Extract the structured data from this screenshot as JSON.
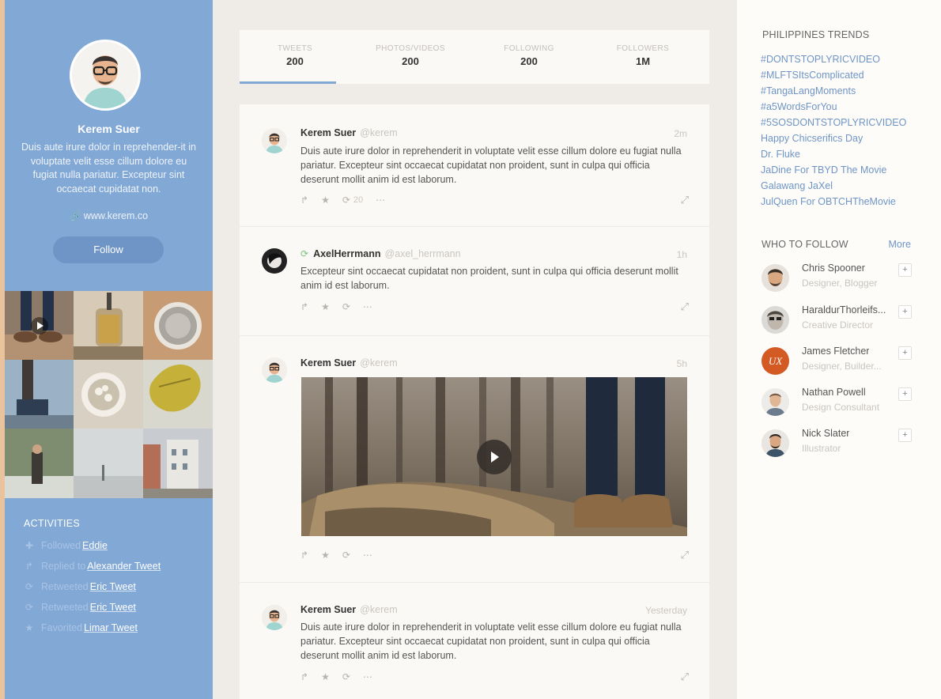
{
  "profile": {
    "name": "Kerem Suer",
    "bio": "Duis aute irure dolor in reprehender-it in voluptate velit esse cillum dolore eu fugiat nulla pariatur. Excepteur sint occaecat cupidatat non.",
    "website": "www.kerem.co",
    "follow_label": "Follow"
  },
  "activities": {
    "title": "ACTIVITIES",
    "items": [
      {
        "icon": "plus-icon",
        "verb": "Followed",
        "target": "Eddie"
      },
      {
        "icon": "reply-icon",
        "verb": "Replied to",
        "target": "Alexander Tweet"
      },
      {
        "icon": "retweet-icon",
        "verb": "Retweeted",
        "target": "Eric Tweet"
      },
      {
        "icon": "retweet-icon",
        "verb": "Retweeted",
        "target": "Eric Tweet"
      },
      {
        "icon": "star-icon",
        "verb": "Favorited",
        "target": "Limar Tweet"
      }
    ]
  },
  "stats": [
    {
      "label": "TWEETS",
      "value": "200"
    },
    {
      "label": "PHOTOS/VIDEOS",
      "value": "200"
    },
    {
      "label": "FOLLOWING",
      "value": "200"
    },
    {
      "label": "FOLLOWERS",
      "value": "1M"
    }
  ],
  "tweets": [
    {
      "name": "Kerem Suer",
      "handle": "@kerem",
      "time": "2m",
      "text": "Duis aute irure dolor in reprehenderit in voluptate velit esse cillum dolore eu fugiat nulla pariatur. Excepteur sint occaecat cupidatat non proident, sunt in culpa qui officia deserunt mollit anim id est laborum.",
      "retweets": "20"
    },
    {
      "name": "AxelHerrmann",
      "handle": "@axel_herrmann",
      "time": "1h",
      "text": "Excepteur sint occaecat cupidatat non proident, sunt in culpa qui officia deserunt mollit anim id est laborum."
    },
    {
      "name": "Kerem Suer",
      "handle": "@kerem",
      "time": "5h"
    },
    {
      "name": "Kerem Suer",
      "handle": "@kerem",
      "time": "Yesterday",
      "text": "Duis aute irure dolor in reprehenderit in voluptate velit esse cillum dolore eu fugiat nulla pariatur. Excepteur sint occaecat cupidatat non proident, sunt in culpa qui officia deserunt mollit anim id est laborum."
    }
  ],
  "trends": {
    "title": "PHILIPPINES TRENDS",
    "items": [
      "#DONTSTOPLYRICVIDEO",
      "#MLFTSItsComplicated",
      "#TangaLangMoments",
      "#a5WordsForYou",
      "#5SOSDONTSTOPLYRICVIDEO",
      "Happy Chicserifics Day",
      "Dr. Fluke",
      "JaDine For TBYD The Movie",
      "Galawang JaXel",
      "JulQuen For OBTCHTheMovie"
    ]
  },
  "who_to_follow": {
    "title": "WHO TO FOLLOW",
    "more_label": "More",
    "add_label": "+",
    "people": [
      {
        "name": "Chris Spooner",
        "role": "Designer, Blogger"
      },
      {
        "name": "HaraldurThorleifs...",
        "role": "Creative Director"
      },
      {
        "name": "James Fletcher",
        "role": "Designer, Builder..."
      },
      {
        "name": "Nathan Powell",
        "role": "Design Consultant"
      },
      {
        "name": "Nick Slater",
        "role": "Illustrator"
      }
    ]
  },
  "colors": {
    "sidebar_blue": "#82a8d6",
    "link_blue": "#6f95c6",
    "feed_bg": "#fbf9f6",
    "page_bg": "#efece7"
  }
}
